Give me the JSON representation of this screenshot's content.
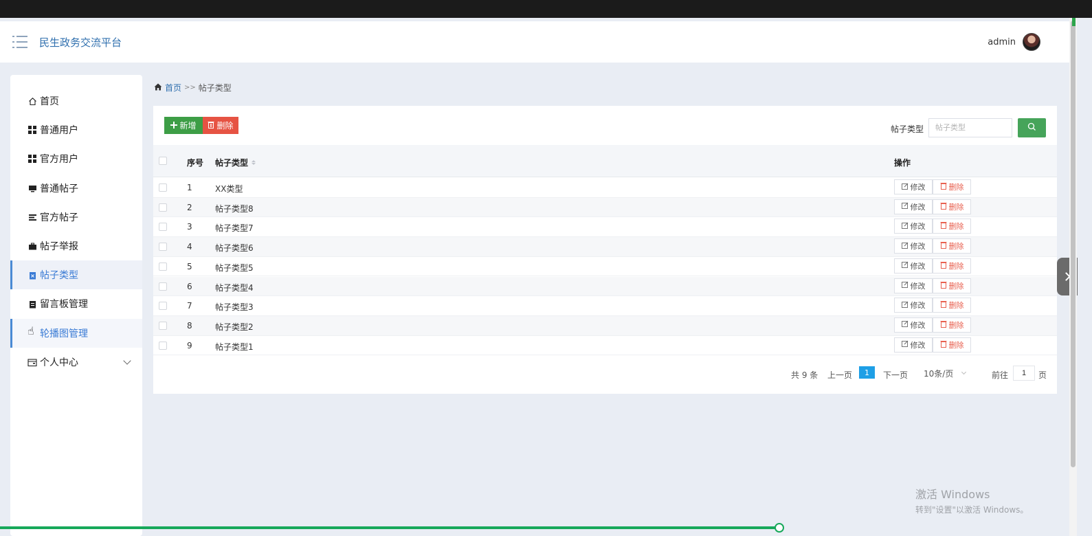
{
  "header": {
    "brand": "民生政务交流平台",
    "username": "admin"
  },
  "sidebar": {
    "items": [
      {
        "label": "首页",
        "icon": "home-icon"
      },
      {
        "label": "普通用户",
        "icon": "grid-icon"
      },
      {
        "label": "官方用户",
        "icon": "grid-icon"
      },
      {
        "label": "普通帖子",
        "icon": "monitor-icon"
      },
      {
        "label": "官方帖子",
        "icon": "list-icon"
      },
      {
        "label": "帖子举报",
        "icon": "briefcase-icon"
      },
      {
        "label": "帖子类型",
        "icon": "clipboard-icon",
        "active": true
      },
      {
        "label": "留言板管理",
        "icon": "clipboard-icon"
      },
      {
        "label": "轮播图管理",
        "icon": "image-icon"
      },
      {
        "label": "个人中心",
        "icon": "wallet-icon",
        "expandable": true
      }
    ]
  },
  "breadcrumb": {
    "home": "首页",
    "separator": ">>",
    "current": "帖子类型"
  },
  "toolbar": {
    "add_label": "新增",
    "delete_label": "删除",
    "search_label": "帖子类型",
    "search_placeholder": "帖子类型"
  },
  "table": {
    "columns": {
      "index": "序号",
      "type": "帖子类型",
      "ops": "操作"
    },
    "edit_label": "修改",
    "delete_label": "删除",
    "rows": [
      {
        "index": "1",
        "type": "XX类型"
      },
      {
        "index": "2",
        "type": "帖子类型8"
      },
      {
        "index": "3",
        "type": "帖子类型7"
      },
      {
        "index": "4",
        "type": "帖子类型6"
      },
      {
        "index": "5",
        "type": "帖子类型5"
      },
      {
        "index": "6",
        "type": "帖子类型4"
      },
      {
        "index": "7",
        "type": "帖子类型3"
      },
      {
        "index": "8",
        "type": "帖子类型2"
      },
      {
        "index": "9",
        "type": "帖子类型1"
      }
    ]
  },
  "pagination": {
    "total": "共 9 条",
    "prev": "上一页",
    "current": "1",
    "next": "下一页",
    "page_size": "10条/页",
    "goto": "前往",
    "goto_value": "1",
    "unit": "页"
  },
  "watermark": {
    "title": "激活 Windows",
    "subtitle": "转到\"设置\"以激活 Windows。"
  },
  "colors": {
    "brand": "#2f6fae",
    "add": "#3d9e46",
    "delete": "#e65343",
    "search": "#46a45a",
    "page_active": "#1e9fe6",
    "progress": "#17a85a"
  }
}
